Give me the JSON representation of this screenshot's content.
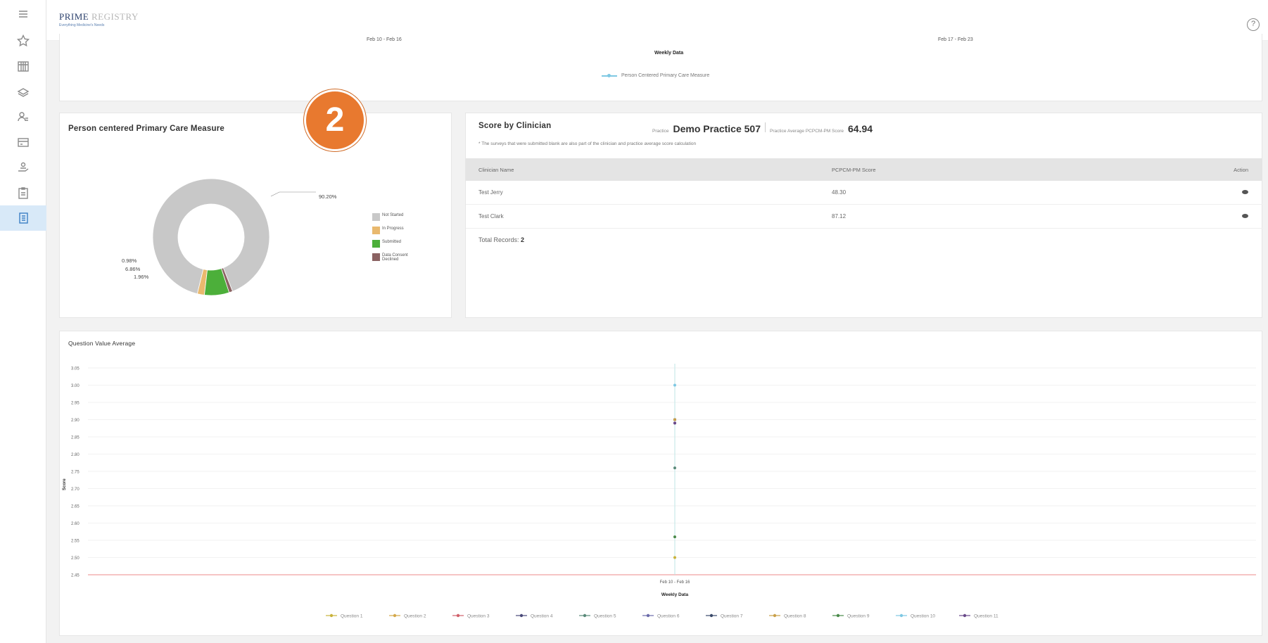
{
  "header": {
    "brand": "PRIME",
    "brand_suffix": "REGISTRY",
    "tagline": "Everything Medicine's Needs",
    "help_icon": "question-circle-icon"
  },
  "sidebar": {
    "items": [
      {
        "icon": "menu-icon"
      },
      {
        "icon": "star-icon"
      },
      {
        "icon": "calendar-grid-icon"
      },
      {
        "icon": "stack-icon"
      },
      {
        "icon": "users-icon"
      },
      {
        "icon": "card-icon"
      },
      {
        "icon": "hand-user-icon"
      },
      {
        "icon": "clipboard-icon"
      },
      {
        "icon": "report-icon",
        "active": true
      }
    ]
  },
  "top_chart": {
    "tick_left": "Feb 10 - Feb 16",
    "tick_right": "Feb 17 - Feb 23",
    "xlabel": "Weekly Data",
    "legend": "Person Centered Primary Care Measure",
    "line_color": "#7ec8e3"
  },
  "badge": "2",
  "pie_card": {
    "title": "Person centered Primary Care Measure"
  },
  "score_card": {
    "title": "Score by Clinician",
    "practice_label": "Practice",
    "practice_name": "Demo Practice 507",
    "avg_label": "Practice Average PCPCM-PM Score",
    "avg_score": "64.94",
    "note": "* The surveys that were submitted blank are also part of the clinician and practice average score calculation",
    "columns": [
      "Clinician Name",
      "PCPCM-PM Score",
      "Action"
    ],
    "rows": [
      {
        "name": "Test Jerry",
        "score": "48.30"
      },
      {
        "name": "Test Clark",
        "score": "87.12"
      }
    ],
    "total_label": "Total Records:",
    "total_value": "2"
  },
  "chart_data": [
    {
      "type": "pie",
      "title": "",
      "labels": [
        "Not Started",
        "In Progress",
        "Submitted",
        "Data Consent Declined"
      ],
      "values": [
        90.2,
        1.96,
        6.86,
        0.98
      ],
      "value_labels": [
        "90.20%",
        "1.96%",
        "6.86%",
        "0.98%"
      ],
      "colors": [
        "#c8c8c8",
        "#e9b96e",
        "#4caf3a",
        "#8b6262"
      ],
      "legend": "right"
    },
    {
      "type": "line",
      "title": "Question Value Average",
      "xlabel": "Weekly Data",
      "ylabel": "Score",
      "categories": [
        "Feb 10 - Feb 16"
      ],
      "yticks": [
        "3.05",
        "3.00",
        "2.95",
        "2.90",
        "2.85",
        "2.80",
        "2.75",
        "2.70",
        "2.65",
        "2.60",
        "2.55",
        "2.50",
        "2.45"
      ],
      "ylim": [
        2.45,
        3.05
      ],
      "grid": true,
      "series": [
        {
          "name": "Question 1",
          "values": [
            2.5
          ],
          "color": "#c9b33b"
        },
        {
          "name": "Question 2",
          "values": [
            2.9
          ],
          "color": "#d4a84a"
        },
        {
          "name": "Question 3",
          "values": [
            2.89
          ],
          "color": "#d0606a"
        },
        {
          "name": "Question 4",
          "values": [
            2.9
          ],
          "color": "#4a4a7a"
        },
        {
          "name": "Question 5",
          "values": [
            2.76
          ],
          "color": "#5a8a7a"
        },
        {
          "name": "Question 6",
          "values": [
            2.89
          ],
          "color": "#6a6aaa"
        },
        {
          "name": "Question 7",
          "values": [
            2.9
          ],
          "color": "#3a4a6a"
        },
        {
          "name": "Question 8",
          "values": [
            2.9
          ],
          "color": "#c9a04a"
        },
        {
          "name": "Question 9",
          "values": [
            2.56
          ],
          "color": "#4a8a4a"
        },
        {
          "name": "Question 10",
          "values": [
            3.0
          ],
          "color": "#7ec8e3"
        },
        {
          "name": "Question 11",
          "values": [
            2.89
          ],
          "color": "#6a4a8a"
        }
      ],
      "legend": "bottom"
    }
  ]
}
